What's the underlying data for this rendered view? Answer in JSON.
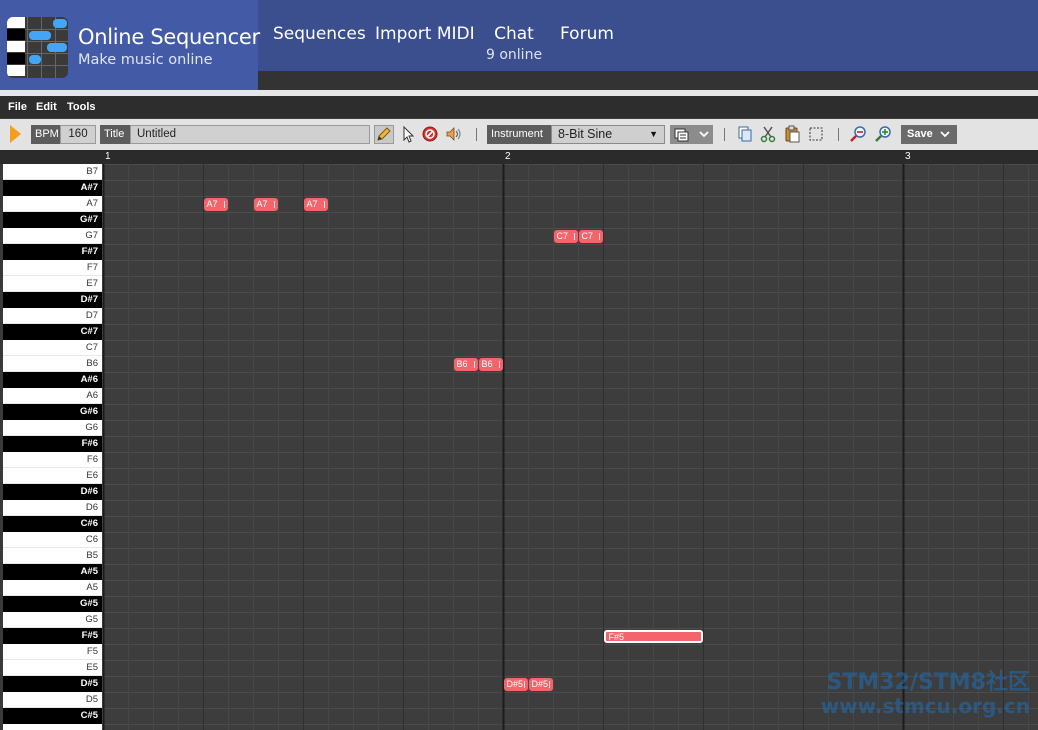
{
  "header": {
    "brand_title": "Online Sequencer",
    "brand_subtitle": "Make music online",
    "nav": {
      "sequences": "Sequences",
      "import_midi": "Import MIDI",
      "chat": "Chat",
      "online_count": "9 online",
      "forum": "Forum"
    }
  },
  "menubar": {
    "file": "File",
    "edit": "Edit",
    "tools": "Tools"
  },
  "toolbar": {
    "bpm_label": "BPM",
    "bpm_value": "160",
    "title_label": "Title",
    "title_value": "Untitled",
    "instrument_label": "Instrument",
    "instrument_value": "8-Bit Sine",
    "save_label": "Save"
  },
  "icons": [
    "play-icon",
    "pencil-icon",
    "pointer-icon",
    "delete-icon",
    "speaker-icon",
    "instrument-settings-icon",
    "copy-icon",
    "cut-icon",
    "paste-icon",
    "select-all-icon",
    "zoom-out-icon",
    "zoom-in-icon",
    "chevron-down-icon"
  ],
  "colors": {
    "header": "#3b4f8f",
    "brand": "#435aa6",
    "note": "#f4656b",
    "play": "#f59e1b",
    "grid": "#3d3d3d"
  },
  "measures": [
    "1",
    "2",
    "3"
  ],
  "keys": [
    "B7",
    "A#7",
    "A7",
    "G#7",
    "G7",
    "F#7",
    "F7",
    "E7",
    "D#7",
    "D7",
    "C#7",
    "C7",
    "B6",
    "A#6",
    "A6",
    "G#6",
    "G6",
    "F#6",
    "F6",
    "E6",
    "D#6",
    "D6",
    "C#6",
    "C6",
    "B5",
    "A#5",
    "A5",
    "G#5",
    "G5",
    "F#5",
    "F5",
    "E5",
    "D#5",
    "D5",
    "C#5"
  ],
  "notes": [
    {
      "label": "A7",
      "pitch": "A7",
      "beat": 4,
      "length": 1
    },
    {
      "label": "A7",
      "pitch": "A7",
      "beat": 6,
      "length": 1
    },
    {
      "label": "A7",
      "pitch": "A7",
      "beat": 8,
      "length": 1
    },
    {
      "label": "C7",
      "pitch": "G7",
      "beat": 18,
      "length": 1
    },
    {
      "label": "C7",
      "pitch": "G7",
      "beat": 19,
      "length": 1
    },
    {
      "label": "B6",
      "pitch": "B6",
      "beat": 14,
      "length": 1
    },
    {
      "label": "B6",
      "pitch": "B6",
      "beat": 15,
      "length": 1
    },
    {
      "label": "F#5",
      "pitch": "F#5",
      "beat": 20,
      "length": 4,
      "selected": true
    },
    {
      "label": "D#5",
      "pitch": "D#5",
      "beat": 16,
      "length": 1
    },
    {
      "label": "D#5",
      "pitch": "D#5",
      "beat": 17,
      "length": 1
    }
  ],
  "watermark": {
    "line1": "STM32/STM8社区",
    "line2": "www.stmcu.org.cn"
  }
}
